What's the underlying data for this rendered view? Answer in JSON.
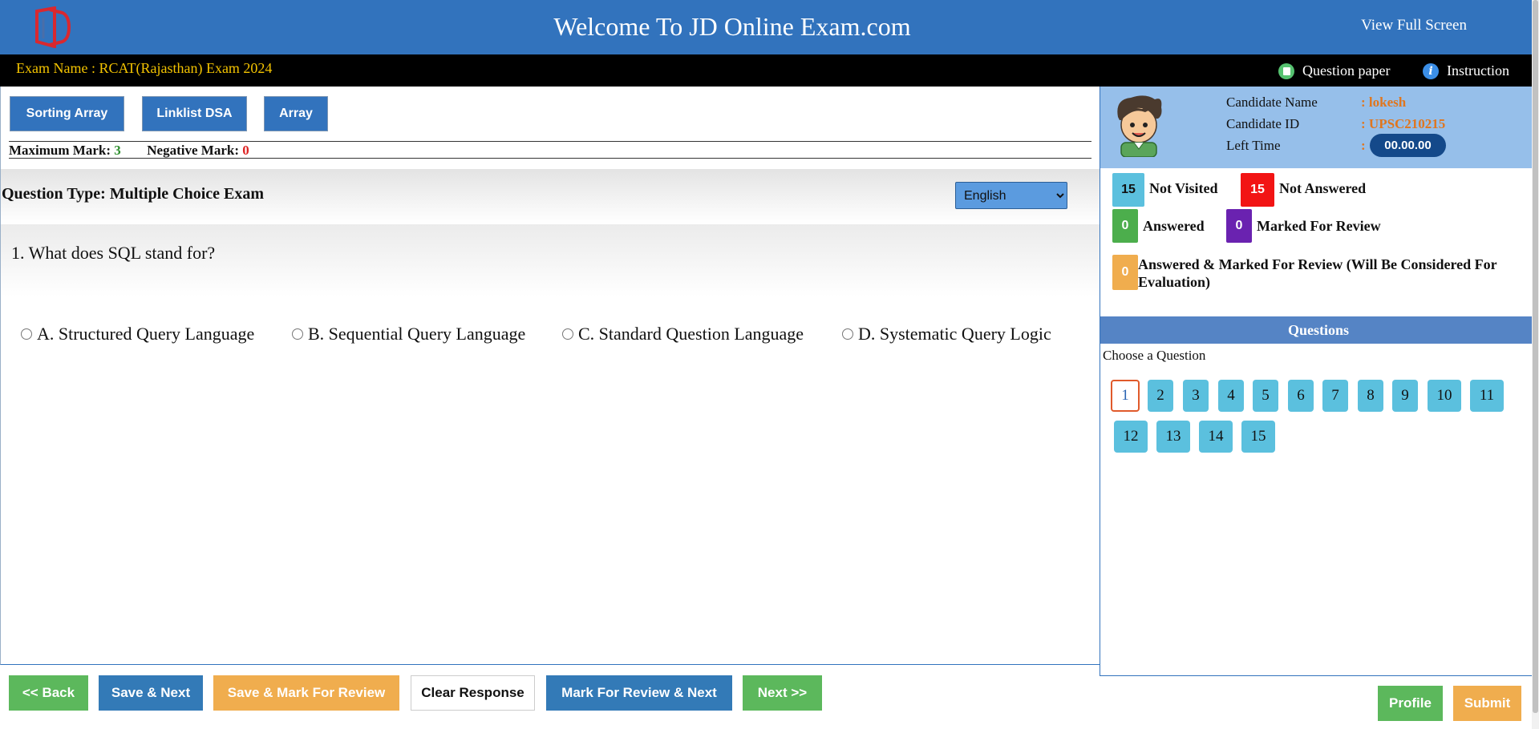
{
  "header": {
    "title": "Welcome To JD Online Exam.com",
    "full_screen": "View Full Screen",
    "logo_color": "#d9282f"
  },
  "exam_bar": {
    "exam_name": "Exam Name : RCAT(Rajasthan) Exam 2024",
    "question_paper": "Question paper",
    "instruction": "Instruction"
  },
  "sections": [
    "Sorting Array",
    "Linklist DSA",
    "Array"
  ],
  "marks": {
    "max_label": "Maximum Mark:",
    "max_value": "3",
    "neg_label": "Negative Mark:",
    "neg_value": "0"
  },
  "question": {
    "type_label": "Question Type: Multiple Choice Exam",
    "language": "English",
    "text": "1. What does SQL stand for?",
    "options": [
      "A. Structured Query Language",
      "B. Sequential Query Language",
      "C. Standard Question Language",
      "D. Systematic Query Logic"
    ]
  },
  "actions": {
    "back": "<< Back",
    "save_next": "Save & Next",
    "save_mark": "Save & Mark For Review",
    "clear": "Clear Response",
    "mark_next": "Mark For Review & Next",
    "next": "Next >>"
  },
  "candidate": {
    "name_label": "Candidate Name",
    "name_value": ": lokesh",
    "id_label": "Candidate ID",
    "id_value": ": UPSC210215",
    "time_label": "Left Time",
    "time_colon": ":",
    "time_value": "00.00.00"
  },
  "legend": {
    "not_visited": {
      "count": "15",
      "label": "Not Visited",
      "color": "#5bc0de"
    },
    "not_answered": {
      "count": "15",
      "label": "Not Answered",
      "color": "#f21414"
    },
    "answered": {
      "count": "0",
      "label": "Answered",
      "color": "#4cae4c"
    },
    "marked": {
      "count": "0",
      "label": "Marked For Review",
      "color": "#6a22b0"
    },
    "answered_marked": {
      "count": "0",
      "label": "Answered & Marked For Review (Will Be Considered For Evaluation)",
      "color": "#f0ad4e"
    }
  },
  "palette": {
    "header": "Questions",
    "choose": "Choose a Question",
    "numbers": [
      "1",
      "2",
      "3",
      "4",
      "5",
      "6",
      "7",
      "8",
      "9",
      "10",
      "11",
      "12",
      "13",
      "14",
      "15"
    ],
    "current": "1"
  },
  "side_actions": {
    "profile": "Profile",
    "submit": "Submit"
  }
}
